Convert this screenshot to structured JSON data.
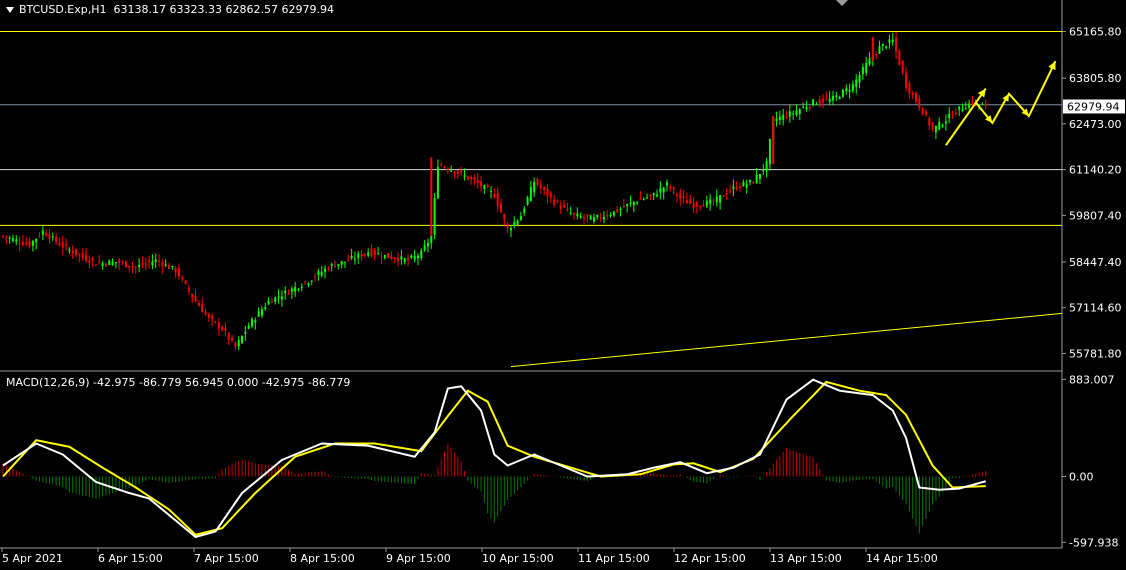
{
  "header": {
    "symbol": "BTCUSD.Exp,H1",
    "ohlc": "63138.17 63323.33 62862.57 62979.94",
    "dropdown_icon": "triangle-down-icon"
  },
  "macd_header": {
    "label": "MACD(12,26,9) -42.975 -86.779 56.945 0.000 -42.975 -86.779"
  },
  "colors": {
    "background": "#000000",
    "bull": "#00ff00",
    "bear": "#ff0000",
    "hline": "#ffff00",
    "grid_line": "#7f8fa6",
    "macd_main": "#ffffff",
    "macd_signal": "#ffff00",
    "axis_text": "#ffffff"
  },
  "chart_data": [
    {
      "type": "candlestick",
      "title": "BTCUSD.Exp,H1",
      "ylim": [
        55300,
        65500
      ],
      "y_ticks": [
        "65165.80",
        "63805.80",
        "62473.00",
        "61140.20",
        "59807.40",
        "58447.40",
        "57114.60",
        "55781.80"
      ],
      "current_price": "62979.94",
      "x_ticks": [
        "5 Apr 2021",
        "6 Apr 15:00",
        "7 Apr 15:00",
        "8 Apr 15:00",
        "9 Apr 15:00",
        "10 Apr 15:00",
        "11 Apr 15:00",
        "12 Apr 15:00",
        "13 Apr 15:00",
        "14 Apr 15:00"
      ],
      "close_anchors": [
        [
          0,
          59200
        ],
        [
          8,
          58950
        ],
        [
          12,
          59350
        ],
        [
          18,
          58900
        ],
        [
          22,
          58700
        ],
        [
          28,
          58400
        ],
        [
          34,
          58450
        ],
        [
          40,
          58300
        ],
        [
          46,
          58500
        ],
        [
          52,
          58200
        ],
        [
          58,
          57300
        ],
        [
          62,
          56800
        ],
        [
          66,
          56500
        ],
        [
          70,
          55950
        ],
        [
          74,
          56600
        ],
        [
          80,
          57300
        ],
        [
          86,
          57600
        ],
        [
          92,
          57900
        ],
        [
          98,
          58300
        ],
        [
          104,
          58500
        ],
        [
          110,
          58750
        ],
        [
          116,
          58600
        ],
        [
          122,
          58500
        ],
        [
          126,
          58700
        ],
        [
          129,
          59200
        ],
        [
          131,
          61300
        ],
        [
          136,
          61100
        ],
        [
          142,
          60800
        ],
        [
          148,
          60400
        ],
        [
          152,
          59400
        ],
        [
          156,
          59800
        ],
        [
          160,
          60800
        ],
        [
          166,
          60200
        ],
        [
          172,
          59800
        ],
        [
          178,
          59700
        ],
        [
          184,
          59900
        ],
        [
          190,
          60200
        ],
        [
          196,
          60400
        ],
        [
          200,
          60700
        ],
        [
          204,
          60300
        ],
        [
          208,
          60100
        ],
        [
          214,
          60200
        ],
        [
          220,
          60600
        ],
        [
          226,
          60800
        ],
        [
          230,
          61300
        ],
        [
          232,
          62600
        ],
        [
          238,
          62800
        ],
        [
          244,
          63100
        ],
        [
          250,
          63200
        ],
        [
          256,
          63600
        ],
        [
          260,
          64200
        ],
        [
          264,
          64700
        ],
        [
          268,
          64900
        ],
        [
          272,
          63600
        ],
        [
          276,
          63000
        ],
        [
          280,
          62300
        ],
        [
          284,
          62600
        ],
        [
          288,
          62900
        ],
        [
          292,
          63100
        ],
        [
          296,
          62980
        ]
      ],
      "bear_spikes": [
        [
          129,
          59200,
          61500
        ],
        [
          232,
          61300,
          62700
        ],
        [
          262,
          64300,
          65000
        ]
      ],
      "horizontal_levels": [
        65165.8,
        63031,
        61140.2,
        59514
      ],
      "annotation_arrows": [
        [
          [
            284,
            61850
          ],
          [
            296,
            63500
          ]
        ],
        [
          [
            293,
            63100
          ],
          [
            298,
            62500
          ],
          [
            303,
            63350
          ],
          [
            309,
            62700
          ],
          [
            317,
            64300
          ]
        ]
      ],
      "trendline": [
        [
          153,
          55400
        ],
        [
          313,
          56950
        ]
      ]
    },
    {
      "type": "macd",
      "title": "MACD(12,26,9)",
      "params": [
        12,
        26,
        9
      ],
      "values": [
        -42.975,
        -86.779,
        56.945,
        0.0,
        -42.975,
        -86.779
      ],
      "ylim": [
        -650,
        950
      ],
      "y_ticks": [
        "883.007",
        "0.00",
        "-597.938"
      ],
      "main_anchors": [
        [
          0,
          100
        ],
        [
          10,
          300
        ],
        [
          18,
          200
        ],
        [
          28,
          -50
        ],
        [
          38,
          -150
        ],
        [
          44,
          -200
        ],
        [
          52,
          -400
        ],
        [
          58,
          -550
        ],
        [
          64,
          -500
        ],
        [
          72,
          -150
        ],
        [
          84,
          150
        ],
        [
          96,
          300
        ],
        [
          110,
          280
        ],
        [
          124,
          180
        ],
        [
          130,
          400
        ],
        [
          134,
          800
        ],
        [
          138,
          820
        ],
        [
          144,
          600
        ],
        [
          148,
          200
        ],
        [
          152,
          100
        ],
        [
          160,
          200
        ],
        [
          168,
          100
        ],
        [
          176,
          0
        ],
        [
          188,
          20
        ],
        [
          196,
          80
        ],
        [
          204,
          130
        ],
        [
          212,
          30
        ],
        [
          220,
          80
        ],
        [
          228,
          200
        ],
        [
          236,
          700
        ],
        [
          244,
          880
        ],
        [
          252,
          780
        ],
        [
          262,
          740
        ],
        [
          268,
          600
        ],
        [
          272,
          350
        ],
        [
          276,
          -100
        ],
        [
          282,
          -120
        ],
        [
          288,
          -110
        ],
        [
          296,
          -43
        ]
      ],
      "signal_anchors": [
        [
          0,
          0
        ],
        [
          10,
          330
        ],
        [
          20,
          270
        ],
        [
          30,
          80
        ],
        [
          40,
          -100
        ],
        [
          50,
          -300
        ],
        [
          58,
          -530
        ],
        [
          66,
          -470
        ],
        [
          76,
          -150
        ],
        [
          88,
          180
        ],
        [
          100,
          300
        ],
        [
          112,
          300
        ],
        [
          126,
          230
        ],
        [
          134,
          550
        ],
        [
          140,
          780
        ],
        [
          146,
          680
        ],
        [
          152,
          280
        ],
        [
          160,
          180
        ],
        [
          170,
          90
        ],
        [
          180,
          0
        ],
        [
          192,
          20
        ],
        [
          202,
          110
        ],
        [
          208,
          120
        ],
        [
          216,
          40
        ],
        [
          226,
          160
        ],
        [
          238,
          550
        ],
        [
          248,
          860
        ],
        [
          258,
          780
        ],
        [
          266,
          740
        ],
        [
          272,
          560
        ],
        [
          280,
          100
        ],
        [
          286,
          -100
        ],
        [
          296,
          -87
        ]
      ]
    }
  ]
}
